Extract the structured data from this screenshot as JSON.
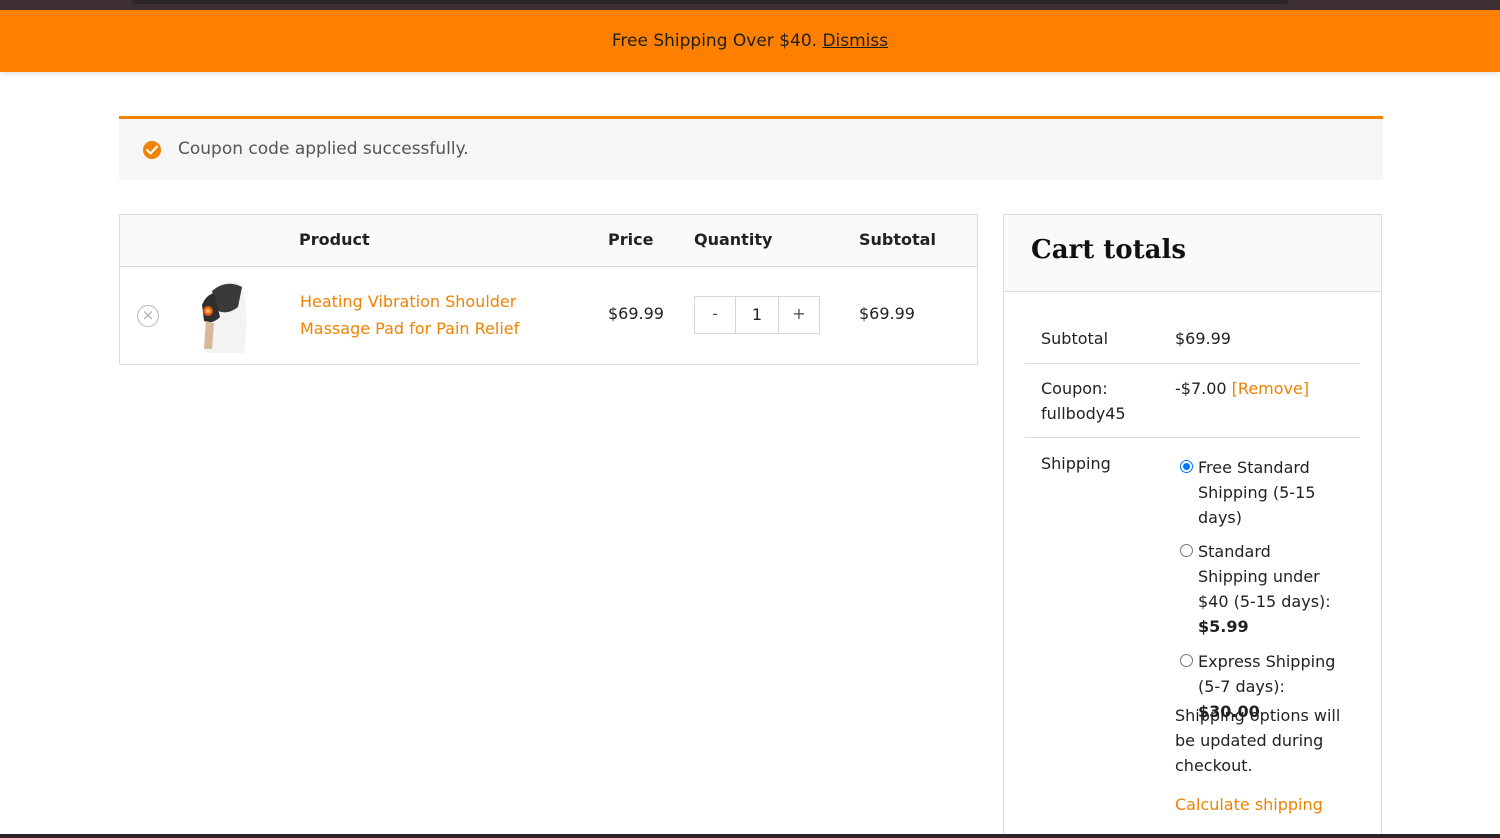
{
  "notice": {
    "text": "Free Shipping Over $40.",
    "dismiss": "Dismiss"
  },
  "coupon_message": {
    "icon": "check-circle-icon",
    "text": "Coupon code applied successfully."
  },
  "cart_table": {
    "headers": {
      "product": "Product",
      "price": "Price",
      "quantity": "Quantity",
      "subtotal": "Subtotal"
    },
    "items": [
      {
        "remove_icon": "remove-icon",
        "remove_symbol": "×",
        "name": "Heating Vibration Shoulder Massage Pad for Pain Relief",
        "price": "$69.99",
        "quantity": "1",
        "minus": "-",
        "plus": "+",
        "subtotal": "$69.99"
      }
    ]
  },
  "cart_totals": {
    "title": "Cart totals",
    "subtotal_label": "Subtotal",
    "subtotal_value": "$69.99",
    "coupon_label": "Coupon: fullbody45",
    "coupon_value": "-$7.00",
    "coupon_remove": "[Remove]",
    "shipping_label": "Shipping",
    "shipping_options": [
      {
        "label": "Free Standard Shipping (5-15 days)",
        "price": "",
        "selected": true
      },
      {
        "label": "Standard Shipping under $40 (5-15 days):",
        "price": "$5.99",
        "selected": false
      },
      {
        "label": "Express Shipping (5-7 days):",
        "price": "$30.00",
        "selected": false
      }
    ],
    "shipping_note": "Shipping options will be updated during checkout.",
    "calculate_shipping": "Calculate shipping"
  },
  "colors": {
    "accent": "#ff8000",
    "link": "#f08200",
    "radio_selected": "#0075ff"
  }
}
